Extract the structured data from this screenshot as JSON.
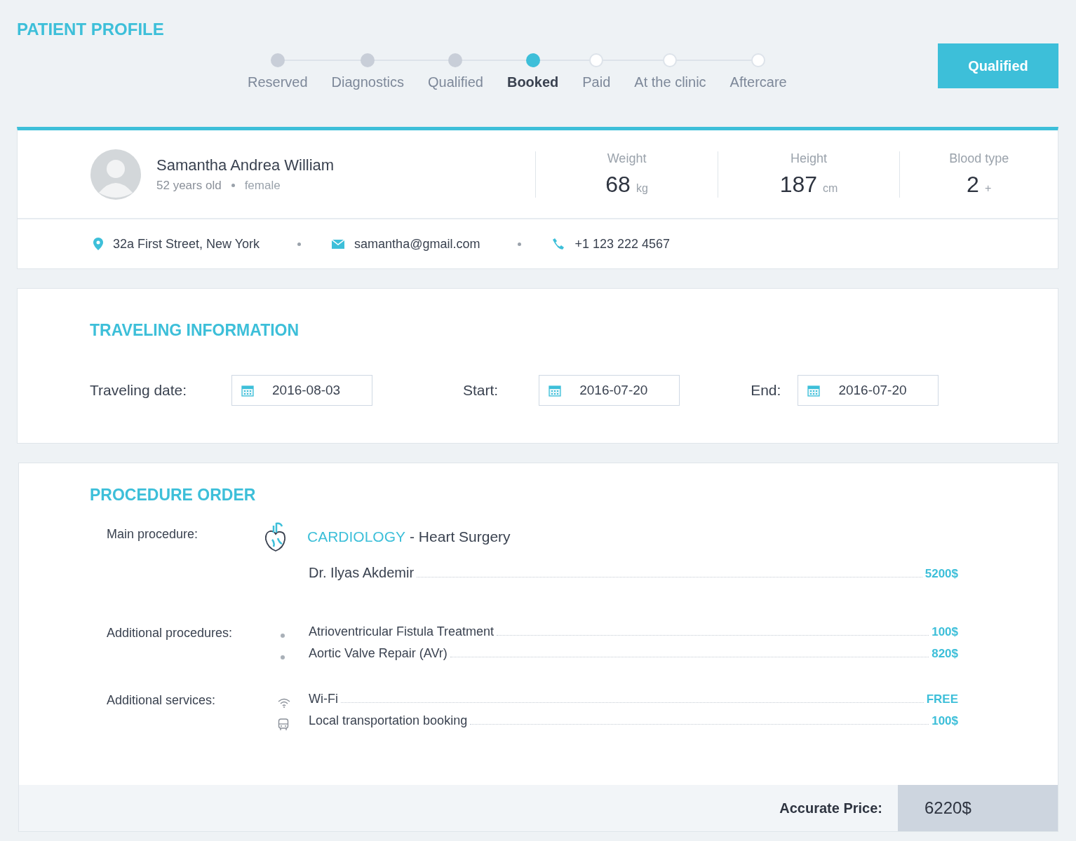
{
  "page_title": "PATIENT PROFILE",
  "steps": [
    {
      "label": "Reserved",
      "completed": true,
      "selected": false
    },
    {
      "label": "Diagnostics",
      "completed": true,
      "selected": false
    },
    {
      "label": "Qualified",
      "completed": true,
      "selected": false
    },
    {
      "label": "Booked",
      "completed": false,
      "selected": true
    },
    {
      "label": "Paid",
      "completed": false,
      "selected": false
    },
    {
      "label": "At the clinic",
      "completed": false,
      "selected": false
    },
    {
      "label": "Aftercare",
      "completed": false,
      "selected": false
    }
  ],
  "status_button": "Qualified",
  "patient": {
    "name": "Samantha Andrea William",
    "age": "52 years old",
    "gender": "female",
    "stats": [
      {
        "label": "Weight",
        "value": "68",
        "unit": "kg"
      },
      {
        "label": "Height",
        "value": "187",
        "unit": "cm"
      },
      {
        "label": "Blood type",
        "value": "2",
        "unit": "+"
      }
    ],
    "address": "32a First Street, New York",
    "email": "samantha@gmail.com",
    "phone": "+1 123 222 4567"
  },
  "traveling": {
    "title": "TRAVELING INFORMATION",
    "fields": [
      {
        "label": "Traveling date:",
        "value": "2016-08-03"
      },
      {
        "label": "Start:",
        "value": "2016-07-20"
      },
      {
        "label": "End:",
        "value": "2016-07-20"
      }
    ]
  },
  "procedure": {
    "title": "PROCEDURE ORDER",
    "main_label": "Main procedure:",
    "specialty": "CARDIOLOGY",
    "procedure_name": "- Heart Surgery",
    "doctor": "Dr. Ilyas Akdemir",
    "main_price": "5200$",
    "additional_label": "Additional procedures:",
    "additional": [
      {
        "name": "Atrioventricular Fistula Treatment",
        "price": "100$"
      },
      {
        "name": "Aortic Valve Repair (AVr)",
        "price": "820$"
      }
    ],
    "services_label": "Additional services:",
    "services": [
      {
        "kind": "wifi",
        "name": "Wi-Fi",
        "price": "FREE"
      },
      {
        "kind": "bus",
        "name": "Local transportation booking",
        "price": "100$"
      }
    ],
    "total_label": "Accurate Price:",
    "total": "6220$"
  }
}
